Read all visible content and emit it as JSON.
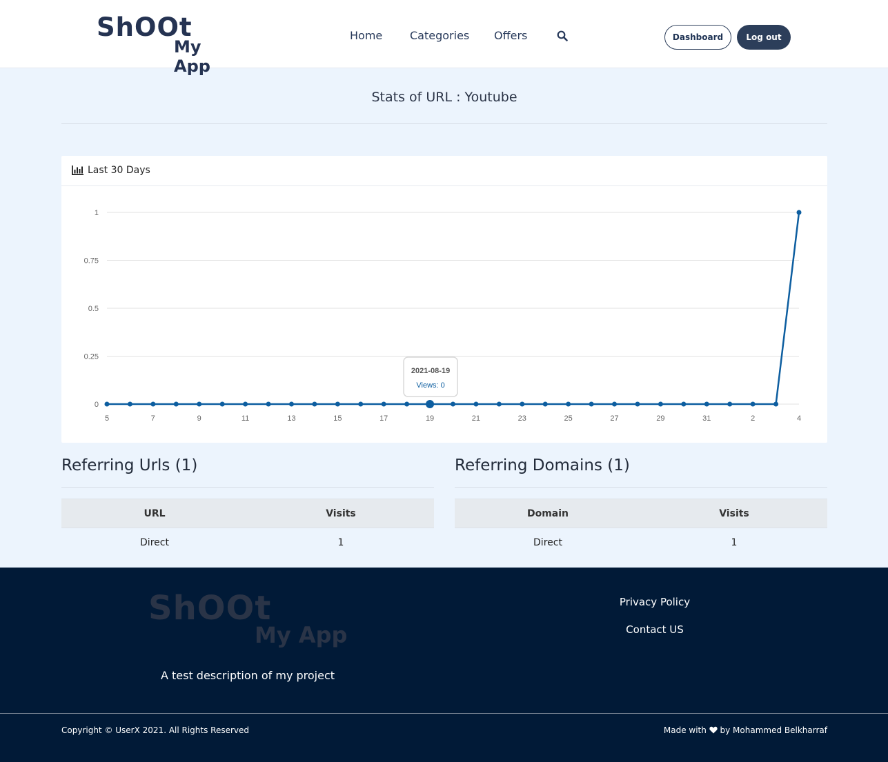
{
  "header": {
    "logo_line1": "ShOOt",
    "logo_line2": "My App",
    "nav": [
      "Home",
      "Categories",
      "Offers"
    ],
    "search_icon": "search-icon",
    "dashboard_label": "Dashboard",
    "logout_label": "Log out"
  },
  "page": {
    "title": "Stats of URL : Youtube"
  },
  "chart_card": {
    "icon": "bar-chart-icon",
    "title": "Last 30 Days"
  },
  "chart_data": {
    "type": "line",
    "title": "",
    "xlabel": "",
    "ylabel": "",
    "x": [
      "5",
      "6",
      "7",
      "8",
      "9",
      "10",
      "11",
      "12",
      "13",
      "14",
      "15",
      "16",
      "17",
      "18",
      "19",
      "20",
      "21",
      "22",
      "23",
      "24",
      "25",
      "26",
      "27",
      "28",
      "29",
      "30",
      "31",
      "1",
      "2",
      "3",
      "4"
    ],
    "x_tick_labels": [
      "5",
      "7",
      "9",
      "11",
      "13",
      "15",
      "17",
      "19",
      "21",
      "23",
      "25",
      "27",
      "29",
      "31",
      "2",
      "4"
    ],
    "y_tick_labels": [
      "0",
      "0.25",
      "0.5",
      "0.75",
      "1"
    ],
    "series": [
      {
        "values": [
          0,
          0,
          0,
          0,
          0,
          0,
          0,
          0,
          0,
          0,
          0,
          0,
          0,
          0,
          0,
          0,
          0,
          0,
          0,
          0,
          0,
          0,
          0,
          0,
          0,
          0,
          0,
          0,
          0,
          0,
          1
        ]
      }
    ],
    "ylim": [
      0,
      1
    ],
    "grid": true,
    "line_color": "#0d5ea0",
    "tooltip": {
      "date": "2021-08-19",
      "text": "Views: 0",
      "index": 14
    }
  },
  "referring_urls": {
    "title": "Referring Urls (1)",
    "columns": [
      "URL",
      "Visits"
    ],
    "rows": [
      [
        "Direct",
        "1"
      ]
    ]
  },
  "referring_domains": {
    "title": "Referring Domains (1)",
    "columns": [
      "Domain",
      "Visits"
    ],
    "rows": [
      [
        "Direct",
        "1"
      ]
    ]
  },
  "footer": {
    "logo_line1": "ShOOt",
    "logo_line2": "My App",
    "description": "A test description of my project",
    "links": [
      "Privacy Policy",
      "Contact US"
    ],
    "copyright": "Copyright © UserX 2021. All Rights Reserved",
    "made_with_prefix": "Made with",
    "made_with_suffix": "by Mohammed Belkharraf",
    "heart_icon": "heart-icon"
  },
  "colors": {
    "brand": "#2c3e5a",
    "page_bg": "#ecf4fd",
    "footer_bg": "#011a37"
  }
}
